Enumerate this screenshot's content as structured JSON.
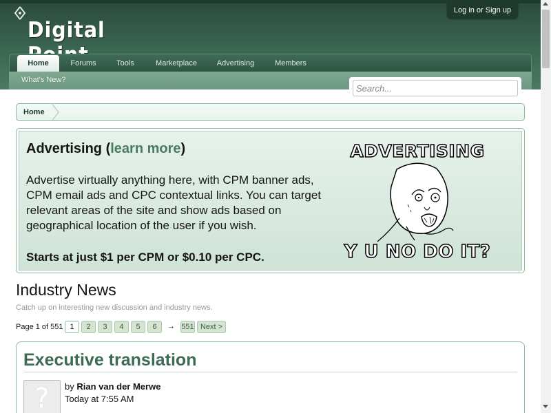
{
  "header": {
    "logo_text": "Digital Point",
    "login_label": "Log in or Sign up",
    "nav_tabs": [
      {
        "label": "Home"
      },
      {
        "label": "Forums"
      },
      {
        "label": "Tools"
      },
      {
        "label": "Marketplace"
      },
      {
        "label": "Advertising"
      },
      {
        "label": "Members"
      }
    ],
    "sub_link": "What's New?",
    "search_placeholder": "Search..."
  },
  "breadcrumb": {
    "home": "Home"
  },
  "ad": {
    "title_prefix": "Advertising (",
    "learn_more": "learn more",
    "title_suffix": ")",
    "description": "Advertise virtually anything here, with CPM banner ads, CPM email ads and CPC contextual links. You can target relevant areas of the site and show ads based on geographical location of the user if you wish.",
    "price": "Starts at just $1 per CPM or $0.10 per CPC.",
    "meme_top": "ADVERTISING",
    "meme_bottom": "Y U NO DO IT?"
  },
  "news": {
    "title": "Industry News",
    "description": "Catch up on interesting new discussion and industry news.",
    "page_label": "Page 1 of 551",
    "pages": [
      "1",
      "2",
      "3",
      "4",
      "5",
      "6"
    ],
    "skip": "→",
    "last_page": "551",
    "next_label": "Next >"
  },
  "article": {
    "title": "Executive translation",
    "by": "by ",
    "author": "Rian van der Merwe",
    "time": "Today at 7:55 AM"
  },
  "colors": {
    "header_green": "#3b6652",
    "accent_green": "#4a7a62",
    "title_green": "#3e6b55",
    "border_green": "#8fb6a0"
  }
}
